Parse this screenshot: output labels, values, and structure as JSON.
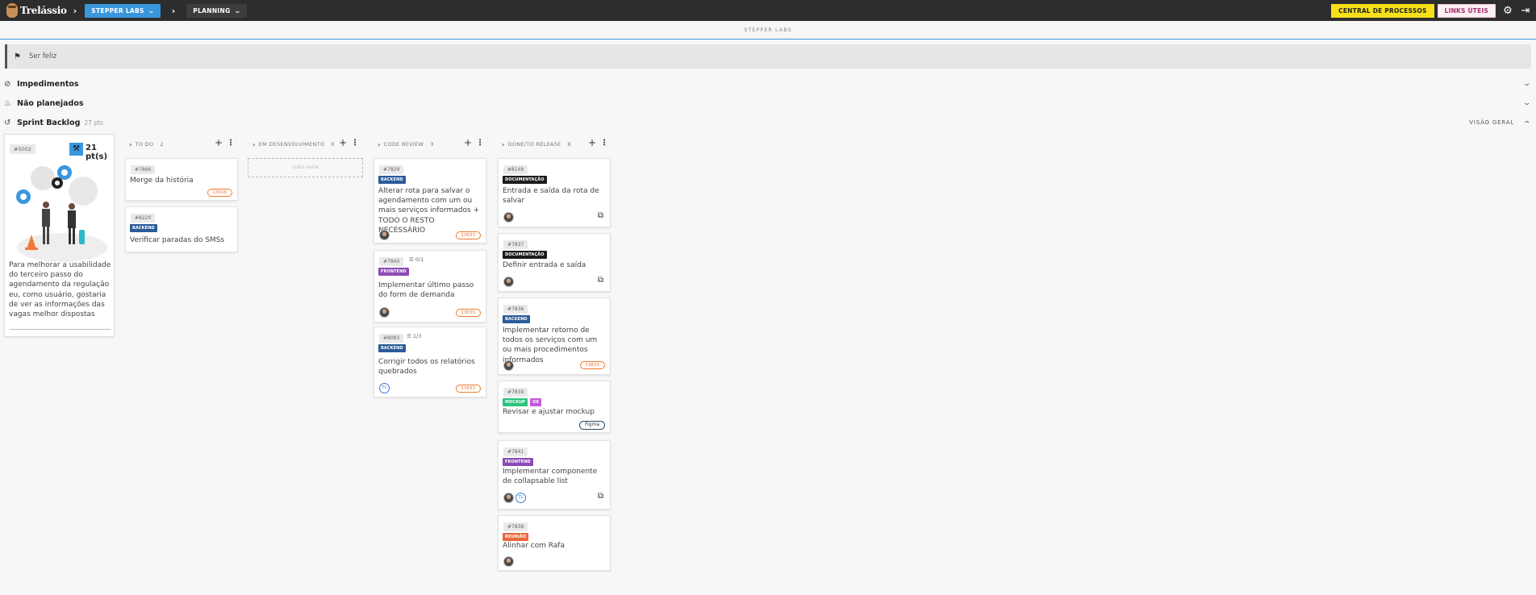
{
  "topbar": {
    "logo_text": "Trelássio",
    "project_label": "STEPPER LABS",
    "view_label": "PLANNING",
    "process_button": "CENTRAL DE PROCESSOS",
    "links_button": "LINKS ÚTEIS"
  },
  "subheader": "STEPPER LABS",
  "goal": "Ser feliz",
  "sections": {
    "impediments": "Impedimentos",
    "unplanned": "Não planejados",
    "sprint": "Sprint Backlog",
    "sprint_points": "27 pts",
    "overview": "VISÃO GERAL"
  },
  "story": {
    "id": "#5002",
    "points": "21 pt(s)",
    "description": "Para melhorar a usabilidade do terceiro passo do agendamento da regulação eu, como usuário, gostaria de ver as informações das vagas melhor dispostas"
  },
  "columns": [
    {
      "title": "TO DO",
      "count": "2",
      "cards": [
        {
          "id": "#7866",
          "title": "Merge da história",
          "pill": "13826"
        },
        {
          "id": "#8220",
          "tags": [
            "BACKEND"
          ],
          "title": "Verificar paradas do SMSs"
        }
      ]
    },
    {
      "title": "EM DESENVOLVIMENTO",
      "count": "0",
      "empty_label": "Lista vazia",
      "cards": []
    },
    {
      "title": "CODE REVIEW",
      "count": "3",
      "cards": [
        {
          "id": "#7829",
          "tags": [
            "BACKEND"
          ],
          "title": "Alterar rota para salvar o agendamento com um ou mais serviços informados + TODO O RESTO NECESSÁRIO",
          "pill": "13833"
        },
        {
          "id": "#7840",
          "sub": "0/1",
          "tags": [
            "FRONTEND"
          ],
          "title": "Implementar último passo do form de demanda",
          "pill": "13835"
        },
        {
          "id": "#8083",
          "sub": "1/3",
          "tags": [
            "BACKEND"
          ],
          "title": "Corrigir todos os relatórios quebrados",
          "avatar_text": "TL",
          "pill": "13833"
        }
      ]
    },
    {
      "title": "DONE/TO RELEASE",
      "count": "6",
      "cards": [
        {
          "id": "#8149",
          "tags": [
            "DOCUMENTAÇÃO"
          ],
          "title": "Entrada e saída da rota de salvar"
        },
        {
          "id": "#7837",
          "tags": [
            "DOCUMENTAÇÃO"
          ],
          "title": "Definir entrada e saída"
        },
        {
          "id": "#7836",
          "tags": [
            "BACKEND"
          ],
          "title": "Implementar retorno de todos os serviços com um ou mais procedimentos informados",
          "pill": "13823"
        },
        {
          "id": "#7839",
          "tags": [
            "MOCKUP",
            "UX"
          ],
          "title": "Revisar e ajustar mockup",
          "pill": "Figma"
        },
        {
          "id": "#7841",
          "tags": [
            "FRONTEND"
          ],
          "title": "Implementar componente de collapsable list",
          "avatar_text": "TL"
        },
        {
          "id": "#7838",
          "tags": [
            "REUNIÃO"
          ],
          "title": "Alinhar com Rafa"
        }
      ]
    }
  ],
  "colors": {
    "topbar": "#2d2d2d",
    "accent_blue": "#3a96dd",
    "yellow": "#f7e01a",
    "pill_orange": "#f0782f"
  }
}
